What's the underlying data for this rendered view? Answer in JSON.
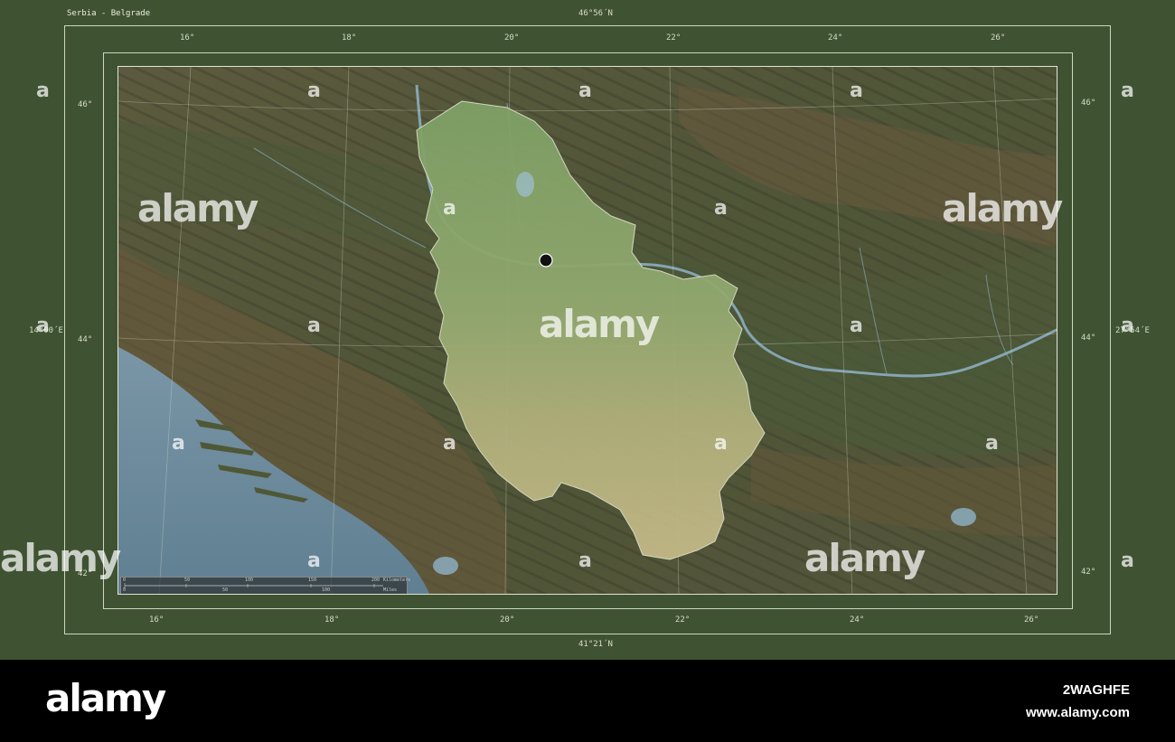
{
  "map": {
    "title": "Serbia - Belgrade",
    "coords": {
      "top": "46°56´N",
      "bottom": "41°21´N",
      "left": "14°00´E",
      "right": "27°54´E"
    },
    "lon_labels_top": [
      "16°",
      "18°",
      "20°",
      "22°",
      "24°",
      "26°"
    ],
    "lon_labels_bottom": [
      "16°",
      "18°",
      "20°",
      "22°",
      "24°",
      "26°"
    ],
    "lat_labels_left": [
      "46°",
      "44°",
      "42°"
    ],
    "lat_labels_right": [
      "46°",
      "44°",
      "42°"
    ],
    "capital_marker": "Belgrade",
    "colors": {
      "frame_bg": "#3f5332",
      "highlight_country": "#8aa56a",
      "surrounding_terrain": "#5a5a3c",
      "sea": "#6f8fa2"
    },
    "scale_bar": {
      "top_ticks": [
        "0",
        "50",
        "100",
        "150",
        "200",
        "Kilometers"
      ],
      "bottom_ticks": [
        "0",
        "50",
        "100",
        "Miles"
      ]
    }
  },
  "watermark": {
    "text": "alamy",
    "short": "a"
  },
  "footer": {
    "logo": "alamy",
    "image_id": "2WAGHFE",
    "url": "www.alamy.com"
  }
}
